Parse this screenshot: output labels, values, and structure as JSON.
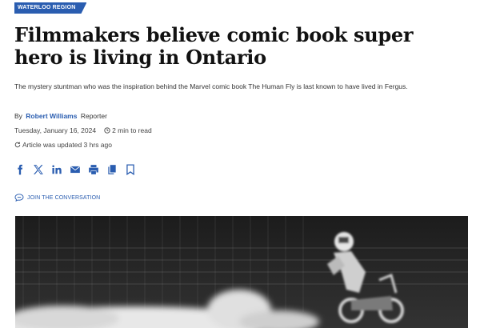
{
  "section_tag": "WATERLOO REGION",
  "headline": "Filmmakers believe comic book super hero is living in Ontario",
  "dek": "The mystery stuntman who was the inspiration behind the Marvel comic book The Human Fly is last known to have lived in Fergus.",
  "byline": {
    "prefix": "By",
    "author": "Robert Williams",
    "role": "Reporter"
  },
  "meta": {
    "date": "Tuesday, January 16, 2024",
    "read_time": "2 min to read",
    "updated": "Article was updated 3 hrs ago"
  },
  "share_icons": [
    "facebook-icon",
    "x-icon",
    "linkedin-icon",
    "email-icon",
    "print-icon",
    "copy-icon",
    "bookmark-icon"
  ],
  "conversation_label": "JOIN THE CONVERSATION",
  "colors": {
    "accent": "#2a5db0",
    "headline": "#111111",
    "photo_bg": "#232323"
  }
}
